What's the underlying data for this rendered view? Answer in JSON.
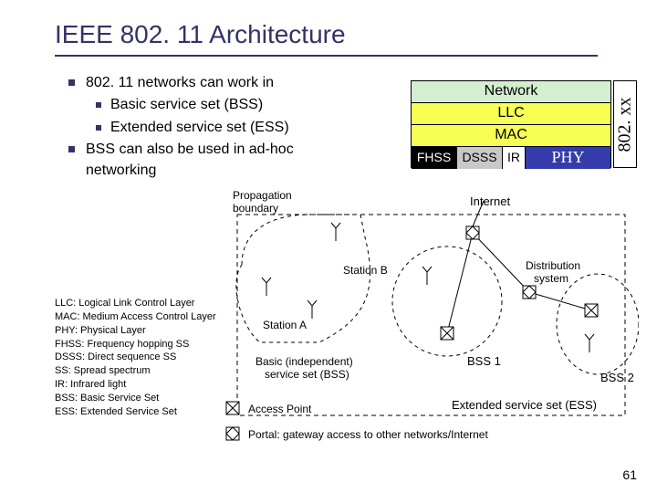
{
  "title": "IEEE 802. 11 Architecture",
  "bullets": {
    "b1": "802. 11 networks can work in",
    "b1a": "Basic service set (BSS)",
    "b1b": "Extended service set (ESS)",
    "b2": "BSS can also be used in ad-hoc networking"
  },
  "stack": {
    "network": "Network",
    "llc": "LLC",
    "mac": "MAC",
    "fhss": "FHSS",
    "dsss": "DSSS",
    "ir": "IR",
    "phy": "PHY",
    "sidelabel": "802. xx"
  },
  "diagram": {
    "propagation": "Propagation",
    "boundary": "boundary",
    "internet": "Internet",
    "stationA": "Station A",
    "stationB": "Station B",
    "bibss1": "Basic (independent)",
    "bibss2": "service set (BSS)",
    "distsys1": "Distribution",
    "distsys2": "system",
    "bss1": "BSS 1",
    "bss2": "BSS 2",
    "ess": "Extended service set (ESS)",
    "ap": "Access Point",
    "portal": "Portal: gateway access to other networks/Internet"
  },
  "glossary": {
    "g1": "LLC: Logical Link Control Layer",
    "g2": "MAC: Medium Access Control Layer",
    "g3": "PHY: Physical Layer",
    "g4": "FHSS: Frequency hopping SS",
    "g5": "DSSS: Direct sequence SS",
    "g6": "SS: Spread spectrum",
    "g7": "IR: Infrared light",
    "g8": "BSS: Basic Service Set",
    "g9": "ESS: Extended Service Set"
  },
  "pagenum": "61"
}
